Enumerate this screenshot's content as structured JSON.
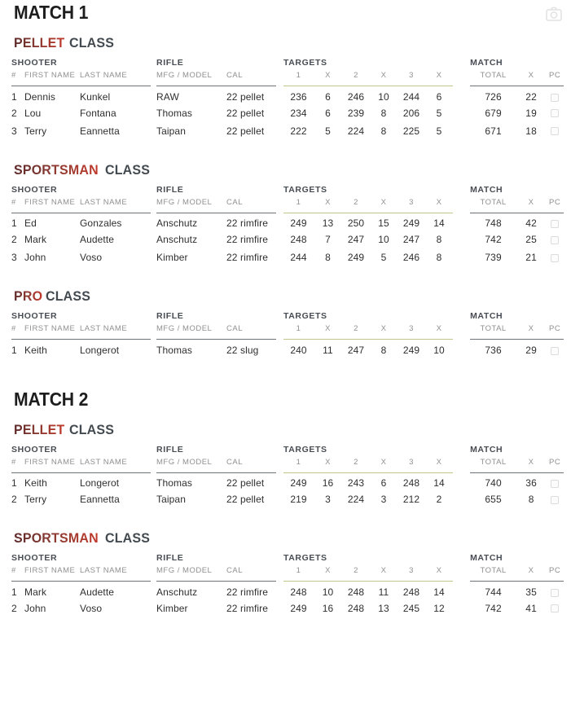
{
  "page": {
    "camera_icon": "camera-icon",
    "background": "#ffffff",
    "accent_gradient_from": "#5e2a2a",
    "accent_gradient_to": "#c0392b",
    "rule_dark": "#6d7379",
    "rule_olive": "#c2c48c"
  },
  "columns": {
    "group": {
      "shooter": "SHOOTER",
      "rifle": "RIFLE",
      "targets": "TARGETS",
      "match": "MATCH"
    },
    "sub": {
      "rank": "#",
      "first_name": "FIRST NAME",
      "last_name": "LAST NAME",
      "mfg_model": "MFG / MODEL",
      "cal": "CAL",
      "t1": "1",
      "t1x": "X",
      "t2": "2",
      "t2x": "X",
      "t3": "3",
      "t3x": "X",
      "total": "TOTAL",
      "match_x": "X",
      "pc": "PC"
    }
  },
  "class_suffix": "CLASS",
  "matches": [
    {
      "title": "MATCH 1",
      "classes": [
        {
          "name": "PELLET",
          "rows": [
            {
              "rank": "1",
              "first": "Dennis",
              "last": "Kunkel",
              "mfg": "RAW",
              "cal": "22 pellet",
              "t1": "236",
              "x1": "6",
              "t2": "246",
              "x2": "10",
              "t3": "244",
              "x3": "6",
              "total": "726",
              "x": "22",
              "pc": false
            },
            {
              "rank": "2",
              "first": "Lou",
              "last": "Fontana",
              "mfg": "Thomas",
              "cal": "22 pellet",
              "t1": "234",
              "x1": "6",
              "t2": "239",
              "x2": "8",
              "t3": "206",
              "x3": "5",
              "total": "679",
              "x": "19",
              "pc": false
            },
            {
              "rank": "3",
              "first": "Terry",
              "last": "Eannetta",
              "mfg": "Taipan",
              "cal": "22 pellet",
              "t1": "222",
              "x1": "5",
              "t2": "224",
              "x2": "8",
              "t3": "225",
              "x3": "5",
              "total": "671",
              "x": "18",
              "pc": false
            }
          ]
        },
        {
          "name": "SPORTSMAN",
          "rows": [
            {
              "rank": "1",
              "first": "Ed",
              "last": "Gonzales",
              "mfg": "Anschutz",
              "cal": "22 rimfire",
              "t1": "249",
              "x1": "13",
              "t2": "250",
              "x2": "15",
              "t3": "249",
              "x3": "14",
              "total": "748",
              "x": "42",
              "pc": false
            },
            {
              "rank": "2",
              "first": "Mark",
              "last": "Audette",
              "mfg": "Anschutz",
              "cal": "22 rimfire",
              "t1": "248",
              "x1": "7",
              "t2": "247",
              "x2": "10",
              "t3": "247",
              "x3": "8",
              "total": "742",
              "x": "25",
              "pc": false
            },
            {
              "rank": "3",
              "first": "John",
              "last": "Voso",
              "mfg": "Kimber",
              "cal": "22 rimfire",
              "t1": "244",
              "x1": "8",
              "t2": "249",
              "x2": "5",
              "t3": "246",
              "x3": "8",
              "total": "739",
              "x": "21",
              "pc": false
            }
          ]
        },
        {
          "name": "PRO",
          "rows": [
            {
              "rank": "1",
              "first": "Keith",
              "last": "Longerot",
              "mfg": "Thomas",
              "cal": "22 slug",
              "t1": "240",
              "x1": "11",
              "t2": "247",
              "x2": "8",
              "t3": "249",
              "x3": "10",
              "total": "736",
              "x": "29",
              "pc": false
            }
          ]
        }
      ]
    },
    {
      "title": "MATCH 2",
      "classes": [
        {
          "name": "PELLET",
          "rows": [
            {
              "rank": "1",
              "first": "Keith",
              "last": "Longerot",
              "mfg": "Thomas",
              "cal": "22 pellet",
              "t1": "249",
              "x1": "16",
              "t2": "243",
              "x2": "6",
              "t3": "248",
              "x3": "14",
              "total": "740",
              "x": "36",
              "pc": false
            },
            {
              "rank": "2",
              "first": "Terry",
              "last": "Eannetta",
              "mfg": "Taipan",
              "cal": "22 pellet",
              "t1": "219",
              "x1": "3",
              "t2": "224",
              "x2": "3",
              "t3": "212",
              "x3": "2",
              "total": "655",
              "x": "8",
              "pc": false
            }
          ]
        },
        {
          "name": "SPORTSMAN",
          "rows": [
            {
              "rank": "1",
              "first": "Mark",
              "last": "Audette",
              "mfg": "Anschutz",
              "cal": "22 rimfire",
              "t1": "248",
              "x1": "10",
              "t2": "248",
              "x2": "11",
              "t3": "248",
              "x3": "14",
              "total": "744",
              "x": "35",
              "pc": false
            },
            {
              "rank": "2",
              "first": "John",
              "last": "Voso",
              "mfg": "Kimber",
              "cal": "22 rimfire",
              "t1": "249",
              "x1": "16",
              "t2": "248",
              "x2": "13",
              "t3": "245",
              "x3": "12",
              "total": "742",
              "x": "41",
              "pc": false
            }
          ]
        }
      ]
    }
  ]
}
